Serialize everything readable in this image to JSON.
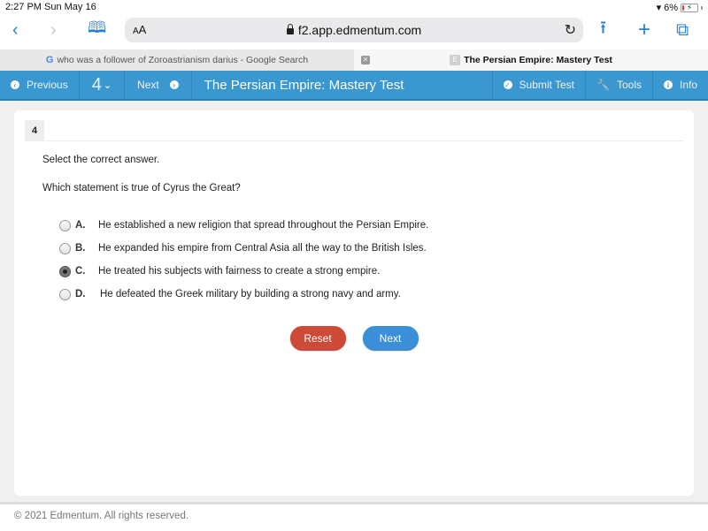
{
  "status": {
    "time": "2:27 PM",
    "date": "Sun May 16",
    "battery": "6%"
  },
  "browser": {
    "aa_label": "AA",
    "url": "f2.app.edmentum.com",
    "tabs": [
      {
        "title": "who was a follower of Zoroastrianism darius - Google Search",
        "icon": "G",
        "active": false
      },
      {
        "title": "The Persian Empire: Mastery Test",
        "icon": "E",
        "active": true
      }
    ]
  },
  "navbar": {
    "previous": "Previous",
    "question_number": "4",
    "next": "Next",
    "title": "The Persian Empire: Mastery Test",
    "submit": "Submit Test",
    "tools": "Tools",
    "info": "Info"
  },
  "question": {
    "number": "4",
    "instruction": "Select the correct answer.",
    "prompt": "Which statement is true of Cyrus the Great?",
    "options": [
      {
        "letter": "A.",
        "text": "He established a new religion that spread throughout the Persian Empire.",
        "selected": false
      },
      {
        "letter": "B.",
        "text": "He expanded his empire from Central Asia all the way to the British Isles.",
        "selected": false
      },
      {
        "letter": "C.",
        "text": "He treated his subjects with fairness to create a strong empire.",
        "selected": true
      },
      {
        "letter": "D.",
        "text": "He defeated the Greek military by building a strong navy and army.",
        "selected": false
      }
    ],
    "reset_label": "Reset",
    "next_label": "Next"
  },
  "footer": {
    "copyright": "© 2021 Edmentum. All rights reserved."
  },
  "colors": {
    "navbar": "#3a97d0",
    "reset": "#cd4b36",
    "next": "#3a8fd8",
    "ios_blue": "#2a7fd6"
  }
}
